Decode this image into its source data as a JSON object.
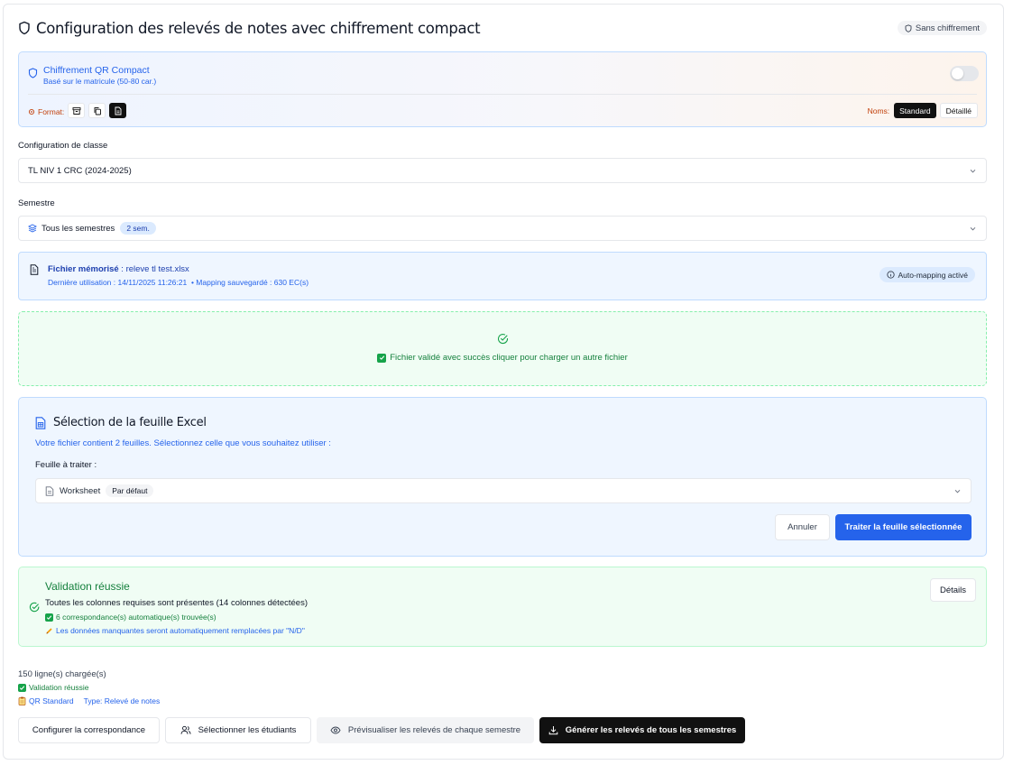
{
  "header": {
    "title": "Configuration des relevés de notes avec chiffrement compact",
    "badge": "Sans chiffrement"
  },
  "qr": {
    "title": "Chiffrement QR Compact",
    "subtitle": "Basé sur le matricule (50-80 car.)",
    "format_label": "Format:",
    "noms_label": "Noms:",
    "noms_standard": "Standard",
    "noms_detail": "Détaillé",
    "enabled": false
  },
  "classe": {
    "label": "Configuration de classe",
    "value": "TL NIV 1 CRC (2024-2025)"
  },
  "semestre": {
    "label": "Semestre",
    "value": "Tous les semestres",
    "count": "2 sem."
  },
  "memo": {
    "bold": "Fichier mémorisé",
    "file": " : releve tl test.xlsx",
    "last_used": "Dernière utilisation : 14/11/2025 11:26:21",
    "mapping": "• Mapping sauvegardé : 630 EC(s)",
    "automap": "Auto-mapping activé"
  },
  "dropzone": {
    "text": "Fichier validé avec succès cliquer pour charger un autre fichier"
  },
  "sheet": {
    "title": "Sélection de la feuille Excel",
    "desc": "Votre fichier contient 2 feuilles. Sélectionnez celle que vous souhaitez utiliser :",
    "label": "Feuille à traiter :",
    "value": "Worksheet",
    "default": "Par défaut",
    "cancel": "Annuler",
    "process": "Traiter la feuille sélectionnée"
  },
  "validation": {
    "title": "Validation réussie",
    "line1": "Toutes les colonnes requises sont présentes (14 colonnes détectées)",
    "line2": "6 correspondance(s) automatique(s) trouvée(s)",
    "line3": "Les données manquantes seront automatiquement remplacées par \"N/D\"",
    "details": "Détails"
  },
  "summary": {
    "rows": "150 ligne(s) chargée(s)",
    "status": "Validation réussie",
    "qr": "QR Standard",
    "type": "Type: Relevé de notes"
  },
  "actions": {
    "mapping": "Configurer la correspondance",
    "students": "Sélectionner les étudiants",
    "preview": "Prévisualiser les relevés de chaque semestre",
    "generate": "Générer les relevés de tous les semestres"
  },
  "colors": {
    "accent": "#2563eb",
    "success": "#16a34a",
    "dark": "#111111",
    "warning": "#c2410c"
  }
}
